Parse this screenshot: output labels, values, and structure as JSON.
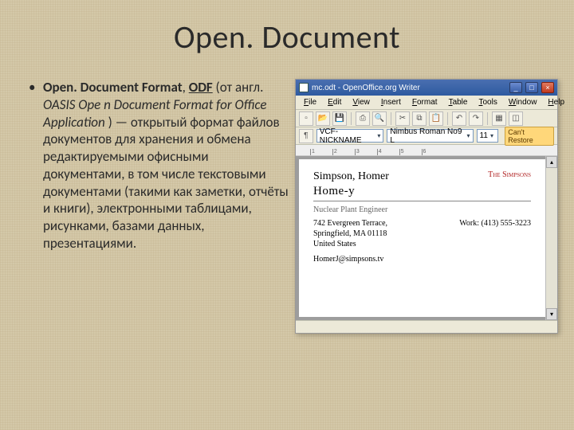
{
  "slide": {
    "title": "Open. Document",
    "bullet": {
      "bold1": "Open. Document Format",
      "sep1": ", ",
      "bold_u": "ODF",
      "plain1": " (от англ. ",
      "ital": "OASIS Ope n Document Format for Office Application",
      "plain2": " ) — открытый формат файлов документов для хранения и обмена редактируемыми офисными документами, в том числе текстовыми документами (такими как заметки, отчёты и книги), электронными таблицами, рисунками, базами данных, презентациями."
    }
  },
  "app": {
    "titlebar": "mc.odt - OpenOffice.org Writer",
    "menus": [
      "File",
      "Edit",
      "View",
      "Insert",
      "Format",
      "Table",
      "Tools",
      "Window",
      "Help"
    ],
    "style_combo": "VCF-NICKNAME",
    "font_combo": "Nimbus Roman No9 L",
    "size_combo": "11",
    "restore_badge": "Can't Restore",
    "ruler_marks": [
      "1",
      "2",
      "3",
      "4",
      "5",
      "6"
    ]
  },
  "doc": {
    "name": "Simpson, Homer",
    "org": "The Simpsons",
    "home": "Home-y",
    "role": "Nuclear Plant Engineer",
    "addr1": "742 Evergreen Terrace,",
    "work": "Work: (413) 555-3223",
    "addr2": "Springfield, MA 01118",
    "addr3": "United States",
    "email": "HomerJ@simpsons.tv"
  }
}
